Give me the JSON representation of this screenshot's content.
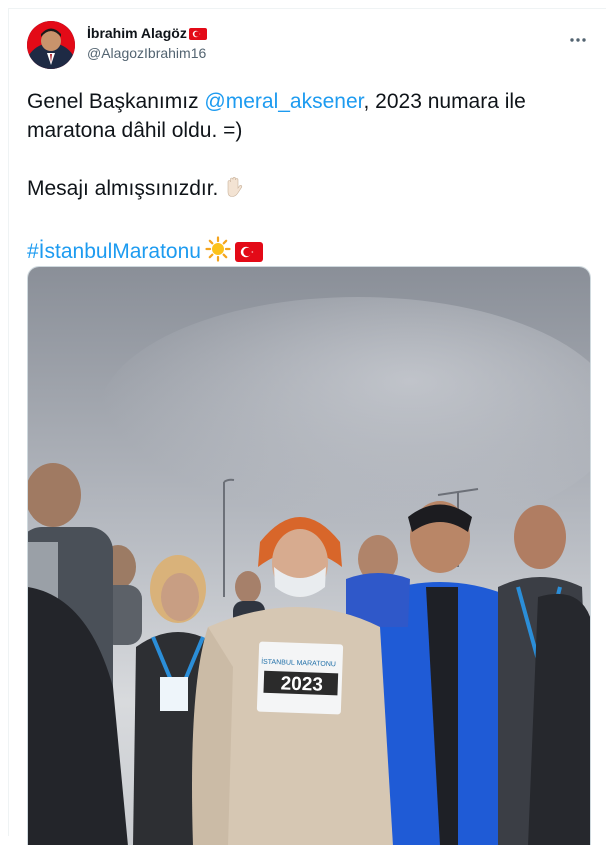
{
  "author": {
    "display_name": "İbrahim Alagöz",
    "handle": "@AlagozIbrahim16",
    "flag_icon": "turkey-flag-icon"
  },
  "more_icon": "more-horizontal-icon",
  "tweet": {
    "line1_prefix": "Genel Başkanımız ",
    "mention": "@meral_aksener",
    "line1_suffix": ", 2023 numara ile",
    "line2": "maratona dâhil oldu. =)",
    "line3": "Mesajı almışsınızdır.",
    "line3_emoji": "raised-hand-icon",
    "hashtag": "#İstanbulMaratonu",
    "hashtag_emojis": [
      "sun-icon",
      "turkey-flag-icon"
    ]
  },
  "media": {
    "bib_number": "2023",
    "bib_event": "İSTANBUL MARATONU"
  },
  "colors": {
    "link": "#1d9bf0",
    "secondary": "#536471",
    "text": "#0f1419"
  }
}
